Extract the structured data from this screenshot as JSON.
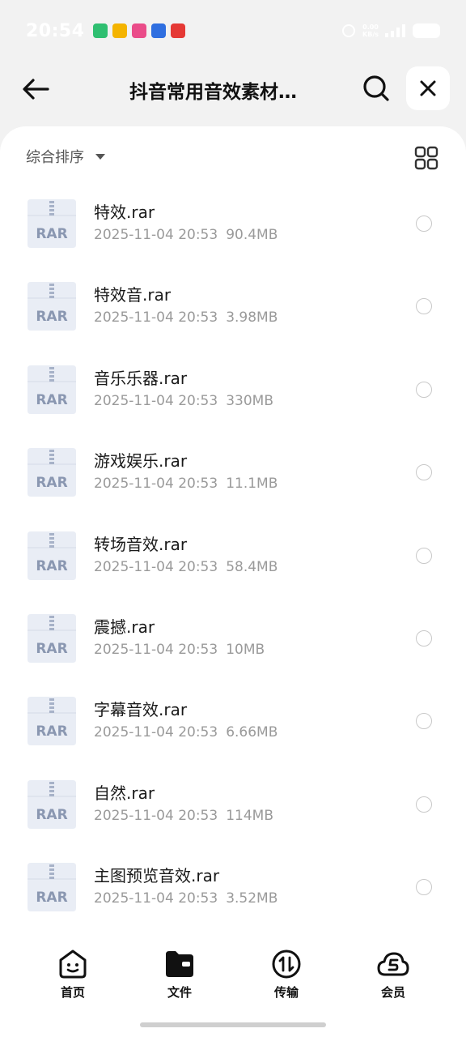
{
  "status": {
    "time": "20:54",
    "notif_icons": [
      {
        "name": "sync-app-icon",
        "color": "#2fbf71"
      },
      {
        "name": "mail-app-icon",
        "color": "#f4b400"
      },
      {
        "name": "chat-app-icon",
        "color": "#ea4c89"
      },
      {
        "name": "baidu-app-icon",
        "color": "#2f6fe0"
      },
      {
        "name": "video-app-icon",
        "color": "#e53935"
      }
    ],
    "net_speed": "0.00",
    "net_unit": "KB/s"
  },
  "header": {
    "title": "抖音常用音效素材…"
  },
  "toolbar": {
    "sort_label": "综合排序"
  },
  "files": [
    {
      "name": "特效.rar",
      "date": "2025-11-04 20:53",
      "size": "90.4MB"
    },
    {
      "name": "特效音.rar",
      "date": "2025-11-04 20:53",
      "size": "3.98MB"
    },
    {
      "name": "音乐乐器.rar",
      "date": "2025-11-04 20:53",
      "size": "330MB"
    },
    {
      "name": "游戏娱乐.rar",
      "date": "2025-11-04 20:53",
      "size": "11.1MB"
    },
    {
      "name": "转场音效.rar",
      "date": "2025-11-04 20:53",
      "size": "58.4MB"
    },
    {
      "name": "震撼.rar",
      "date": "2025-11-04 20:53",
      "size": "10MB"
    },
    {
      "name": "字幕音效.rar",
      "date": "2025-11-04 20:53",
      "size": "6.66MB"
    },
    {
      "name": "自然.rar",
      "date": "2025-11-04 20:53",
      "size": "114MB"
    },
    {
      "name": "主图预览音效.rar",
      "date": "2025-11-04 20:53",
      "size": "3.52MB"
    }
  ],
  "file_icon_label": "RAR",
  "tabs": [
    {
      "label": "首页",
      "icon": "home-face-icon"
    },
    {
      "label": "文件",
      "icon": "folder-icon"
    },
    {
      "label": "传输",
      "icon": "transfer-icon"
    },
    {
      "label": "会员",
      "icon": "vip-cloud-icon"
    }
  ],
  "colors": {
    "background": "#f2f2f2",
    "panel": "#ffffff",
    "rar_icon_body": "#e9edf5",
    "rar_icon_text": "#8a97b1"
  }
}
